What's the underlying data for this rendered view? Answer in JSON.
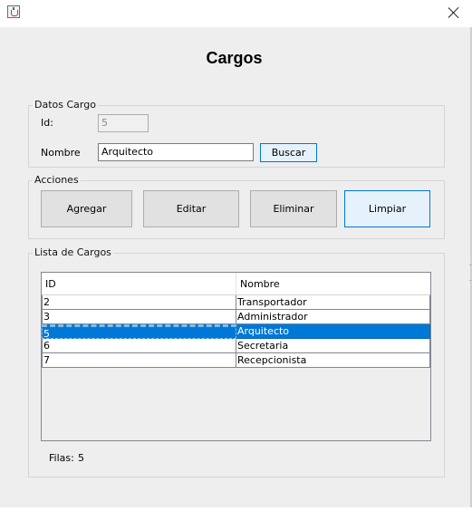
{
  "window": {
    "close_label": "Close"
  },
  "title": "Cargos",
  "datos": {
    "group_title": "Datos Cargo",
    "id_label": "Id:",
    "id_value": "5",
    "nombre_label": "Nombre",
    "nombre_value": "Arquitecto",
    "buscar_label": "Buscar"
  },
  "acciones": {
    "group_title": "Acciones",
    "agregar": "Agregar",
    "editar": "Editar",
    "eliminar": "Eliminar",
    "limpiar": "Limpiar"
  },
  "lista": {
    "group_title": "Lista de Cargos",
    "columns": [
      "ID",
      "Nombre"
    ],
    "rows": [
      {
        "id": "2",
        "nombre": "Transportador",
        "selected": false
      },
      {
        "id": "3",
        "nombre": "Administrador",
        "selected": false
      },
      {
        "id": "5",
        "nombre": "Arquitecto",
        "selected": true
      },
      {
        "id": "6",
        "nombre": "Secretaria",
        "selected": false
      },
      {
        "id": "7",
        "nombre": "Recepcionista",
        "selected": false
      }
    ],
    "count_label": "Filas:",
    "count_value": "5"
  },
  "colors": {
    "selection": "#0078d7",
    "focus_border": "#0078d7",
    "background": "#eeeeee"
  },
  "icons": {
    "app": "java-icon",
    "close": "close-icon"
  }
}
